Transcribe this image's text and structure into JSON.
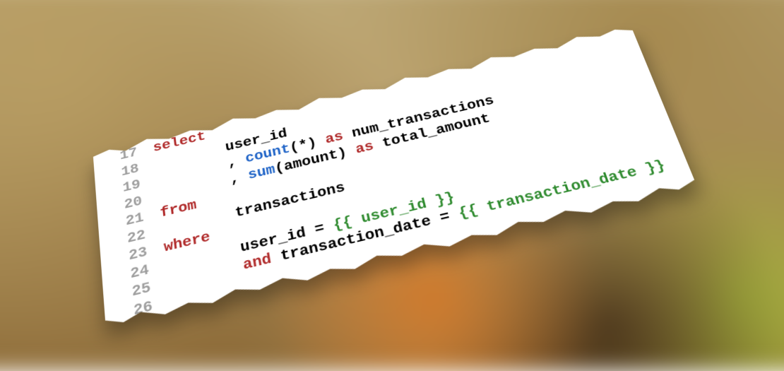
{
  "code": {
    "lines": [
      {
        "num": "17",
        "tokens": [
          {
            "cls": "kw",
            "text": "select"
          }
        ]
      },
      {
        "num": "18",
        "tokens": [
          {
            "cls": "txt",
            "text": "        user_id"
          }
        ]
      },
      {
        "num": "19",
        "tokens": [
          {
            "cls": "txt",
            "text": "        , "
          },
          {
            "cls": "fn",
            "text": "count"
          },
          {
            "cls": "txt",
            "text": "(*) "
          },
          {
            "cls": "kw",
            "text": "as"
          },
          {
            "cls": "txt",
            "text": " num_transactions"
          }
        ]
      },
      {
        "num": "20",
        "tokens": [
          {
            "cls": "txt",
            "text": "        , "
          },
          {
            "cls": "fn",
            "text": "sum"
          },
          {
            "cls": "txt",
            "text": "(amount) "
          },
          {
            "cls": "kw",
            "text": "as"
          },
          {
            "cls": "txt",
            "text": " total_amount"
          }
        ]
      },
      {
        "num": "21",
        "tokens": [
          {
            "cls": "kw",
            "text": "from"
          }
        ]
      },
      {
        "num": "22",
        "tokens": [
          {
            "cls": "txt",
            "text": "        transactions"
          }
        ]
      },
      {
        "num": "23",
        "tokens": [
          {
            "cls": "kw",
            "text": "where"
          }
        ]
      },
      {
        "num": "24",
        "tokens": [
          {
            "cls": "txt",
            "text": "        user_id = "
          },
          {
            "cls": "tmpl",
            "text": "{{ user_id }}"
          }
        ]
      },
      {
        "num": "25",
        "tokens": [
          {
            "cls": "txt",
            "text": "        "
          },
          {
            "cls": "and",
            "text": "and"
          },
          {
            "cls": "txt",
            "text": " transaction_date = "
          },
          {
            "cls": "tmpl",
            "text": "{{ transaction_date }}"
          }
        ]
      },
      {
        "num": "26",
        "tokens": []
      }
    ]
  }
}
